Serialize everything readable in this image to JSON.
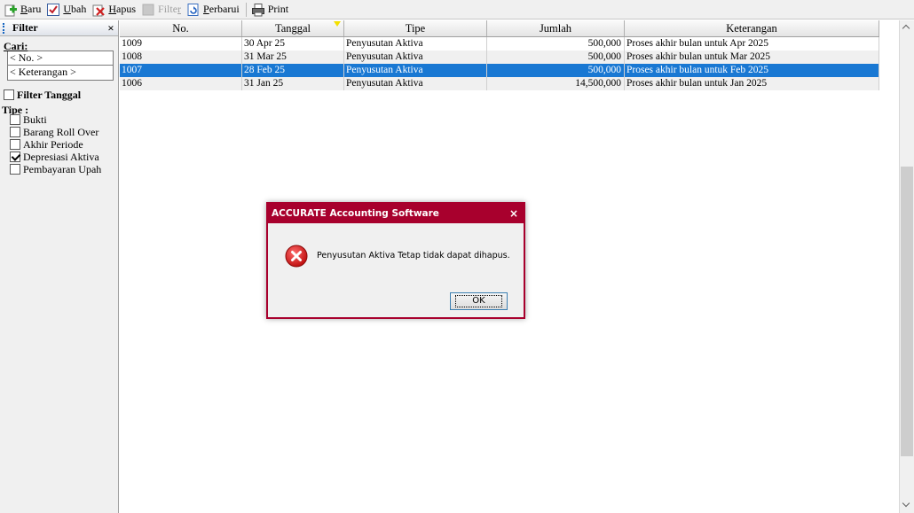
{
  "toolbar": {
    "baru": {
      "pre": "",
      "ul": "B",
      "post": "aru"
    },
    "ubah": {
      "pre": "",
      "ul": "U",
      "post": "bah"
    },
    "hapus": {
      "pre": "",
      "ul": "H",
      "post": "apus"
    },
    "filter": {
      "pre": "Filte",
      "ul": "r",
      "post": ""
    },
    "perbarui": {
      "pre": "",
      "ul": "P",
      "post": "erbarui"
    },
    "print": {
      "pre": "Print",
      "ul": "",
      "post": ""
    }
  },
  "filter_panel": {
    "title": "Filter",
    "close": "×",
    "cari_label": "Cari:",
    "no_placeholder": "< No. >",
    "keterangan_placeholder": "< Keterangan >",
    "filter_tanggal": "Filter Tanggal",
    "tipe_label": "Tipe :",
    "tipe_options": [
      {
        "label": "Bukti",
        "checked": false
      },
      {
        "label": "Barang Roll Over",
        "checked": false
      },
      {
        "label": "Akhir Periode",
        "checked": false
      },
      {
        "label": "Depresiasi Aktiva",
        "checked": true
      },
      {
        "label": "Pembayaran Upah",
        "checked": false
      }
    ]
  },
  "grid": {
    "columns": [
      "No.",
      "Tanggal",
      "Tipe",
      "Jumlah",
      "Keterangan"
    ],
    "rows": [
      {
        "no": "1009",
        "tanggal": "30 Apr 25",
        "tipe": "Penyusutan Aktiva",
        "jumlah": "500,000",
        "keterangan": "Proses akhir bulan untuk Apr 2025"
      },
      {
        "no": "1008",
        "tanggal": "31 Mar 25",
        "tipe": "Penyusutan Aktiva",
        "jumlah": "500,000",
        "keterangan": "Proses akhir bulan untuk Mar 2025"
      },
      {
        "no": "1007",
        "tanggal": "28 Feb 25",
        "tipe": "Penyusutan Aktiva",
        "jumlah": "500,000",
        "keterangan": "Proses akhir bulan untuk Feb 2025"
      },
      {
        "no": "1006",
        "tanggal": "31 Jan 25",
        "tipe": "Penyusutan Aktiva",
        "jumlah": "14,500,000",
        "keterangan": "Proses akhir bulan untuk Jan 2025"
      }
    ],
    "selected_row": 2
  },
  "dialog": {
    "title": "ACCURATE Accounting Software",
    "close": "×",
    "message": "Penyusutan Aktiva Tetap tidak dapat dihapus.",
    "ok_label": "OK"
  },
  "colors": {
    "dialog_accent": "#a8002d",
    "selection": "#1978d3",
    "error_red": "#d61f1f"
  },
  "icons": [
    "add-icon",
    "edit-check-icon",
    "delete-icon",
    "filter-icon",
    "refresh-icon",
    "printer-icon",
    "error-icon"
  ]
}
